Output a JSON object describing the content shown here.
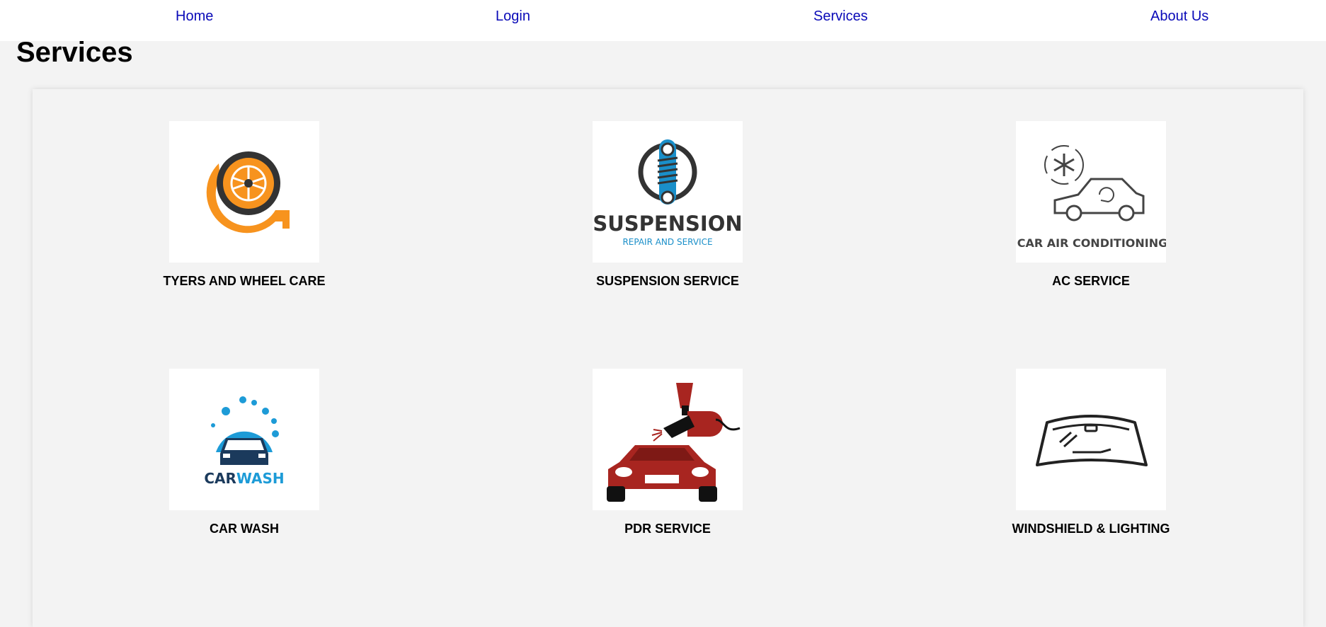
{
  "nav": {
    "home": "Home",
    "login": "Login",
    "services": "Services",
    "about": "About Us"
  },
  "page": {
    "title": "Services"
  },
  "services": [
    {
      "name": "TYERS AND WHEEL CARE",
      "icon": "tyre-wrench-icon"
    },
    {
      "name": "SUSPENSION SERVICE",
      "icon": "suspension-icon",
      "logo_text": "SUSPENSION",
      "logo_subtext": "REPAIR AND SERVICE"
    },
    {
      "name": "AC SERVICE",
      "icon": "car-ac-icon",
      "logo_text": "CAR AIR CONDITIONING"
    },
    {
      "name": "CAR WASH",
      "icon": "car-wash-icon",
      "logo_text_1": "CAR",
      "logo_text_2": "WASH"
    },
    {
      "name": "PDR SERVICE",
      "icon": "paint-spray-car-icon"
    },
    {
      "name": "WINDSHIELD & LIGHTING",
      "icon": "windshield-icon"
    }
  ],
  "colors": {
    "nav_link": "#0a0ab8",
    "background": "#f3f3f3",
    "tyre_orange": "#f7931e",
    "suspension_blue": "#1a8fc9",
    "carwash_blue": "#1d9bd7",
    "pdr_red": "#a82520"
  }
}
